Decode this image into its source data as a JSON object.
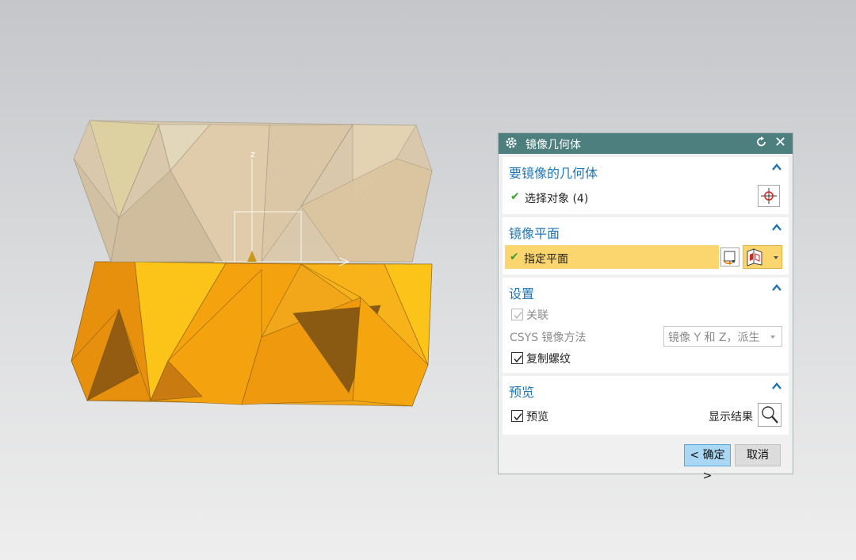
{
  "dialog": {
    "title": "镜像几何体",
    "title_icon": "gear-icon",
    "reset_icon": "reset-icon",
    "close_symbol": "✕"
  },
  "groups": {
    "geometry": {
      "title": "要镜像的几何体",
      "select_object_label": "选择对象 (4)"
    },
    "plane": {
      "title": "镜像平面",
      "specify_plane_label": "指定平面"
    },
    "settings": {
      "title": "设置",
      "associative_label": "关联",
      "associative_checked": true,
      "associative_enabled": false,
      "csys_label": "CSYS 镜像方法",
      "csys_value": "镜像 Y 和 Z，派生",
      "copy_threads_label": "复制螺纹",
      "copy_threads_checked": true
    },
    "preview": {
      "title": "预览",
      "preview_label": "预览",
      "preview_checked": true,
      "show_result_label": "显示结果"
    }
  },
  "buttons": {
    "ok": "< 确定 >",
    "cancel": "取消"
  },
  "colors": {
    "titlebar": "#4e7f7f",
    "group_title": "#1f76b6",
    "highlight_row": "#fbd56e",
    "ok_button": "#aad7f3",
    "solid_orange": "#f09a10",
    "ghost_beige": "#d8c3a2"
  },
  "viewport": {
    "axis_label_z": "z"
  }
}
